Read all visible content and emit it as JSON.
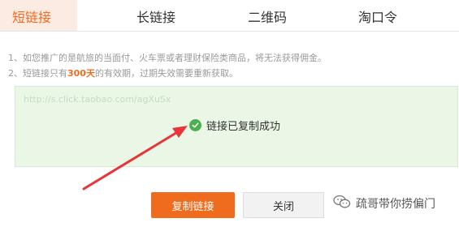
{
  "tabs": [
    {
      "label": "短链接",
      "active": true
    },
    {
      "label": "长链接",
      "active": false
    },
    {
      "label": "二维码",
      "active": false
    },
    {
      "label": "淘口令",
      "active": false
    }
  ],
  "notes": {
    "line1": "1、如您推广的是航旅的当面付、火车票或者理财保险类商品，将无法获得佣金。",
    "line2_prefix": "2、短链接只有",
    "line2_highlight": "300天",
    "line2_suffix": "的有效期，过期失效需要重新获取。"
  },
  "link_box": {
    "url": "http://s.click.taobao.com/agXuSx",
    "success_message": "链接已复制成功"
  },
  "buttons": {
    "copy_label": "复制链接",
    "close_label": "关闭"
  },
  "watermark": {
    "text": "疏哥带你捞偏门"
  },
  "colors": {
    "accent": "#f06b1f",
    "success": "#4caf50",
    "arrow": "#e8353b"
  }
}
